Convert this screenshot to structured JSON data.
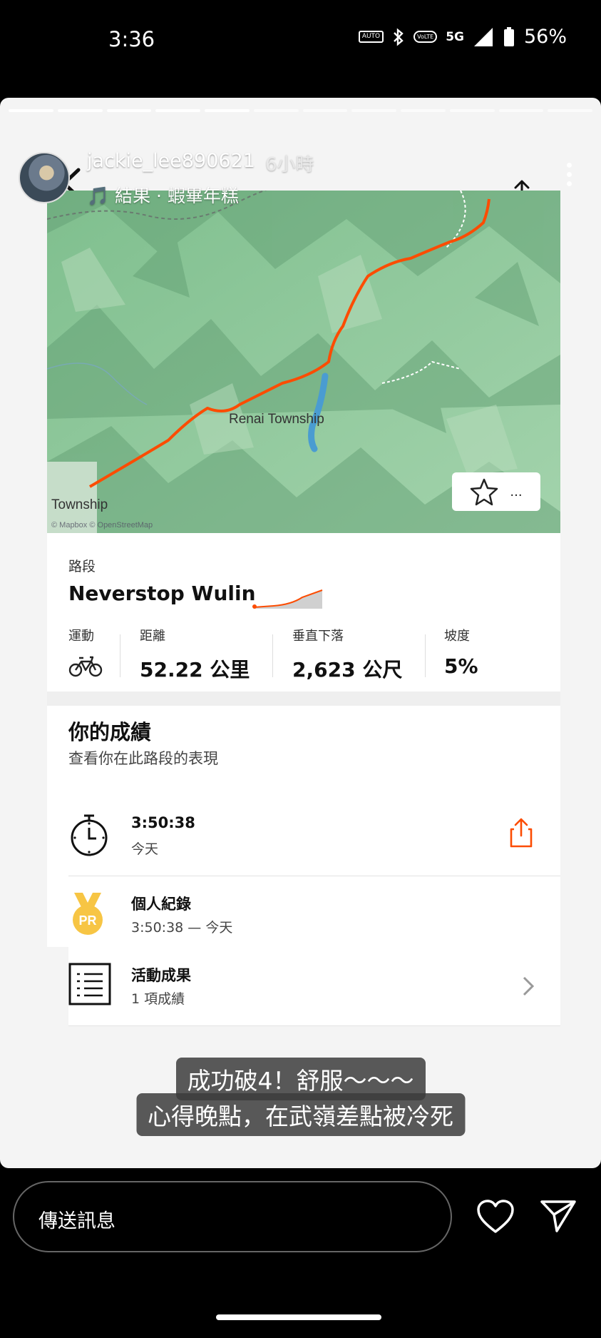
{
  "status_bar": {
    "time": "3:36",
    "auto_label": "AUTO",
    "volte_label": "VoLTE",
    "network": "5G",
    "battery": "56%"
  },
  "story": {
    "username": "jackie_lee890621",
    "time_ago": "6小時",
    "music": "🎵 結果 · 蝦畢年糕",
    "progress_segments": 12,
    "progress_done": 5
  },
  "app": {
    "header_title": "路段",
    "map_labels": {
      "renai": "Renai Township",
      "township": "Township",
      "attribution": "© Mapbox © OpenStreetMap"
    },
    "star_more": "...",
    "segment": {
      "label": "路段",
      "name": "Neverstop Wulin"
    },
    "stats": [
      {
        "label": "運動",
        "value": ""
      },
      {
        "label": "距離",
        "value": "52.22 公里"
      },
      {
        "label": "垂直下落",
        "value": "2,623 公尺"
      },
      {
        "label": "坡度",
        "value": "5%"
      }
    ],
    "performance": {
      "title": "你的成績",
      "subtitle": "查看你在此路段的表現"
    },
    "rows": [
      {
        "main": "3:50:38",
        "sub": "今天"
      },
      {
        "main": "個人紀錄",
        "sub": "3:50:38 — 今天",
        "badge": "PR"
      },
      {
        "main": "活動成果",
        "sub": "1 項成績"
      }
    ]
  },
  "caption": {
    "line1": "成功破4！舒服～～～",
    "line2": "心得晚點，在武嶺差點被冷死"
  },
  "reply": {
    "placeholder": "傳送訊息"
  },
  "colors": {
    "accent": "#fc4c02",
    "map_green": "#8fc79c",
    "pr_gold": "#f7c544"
  }
}
